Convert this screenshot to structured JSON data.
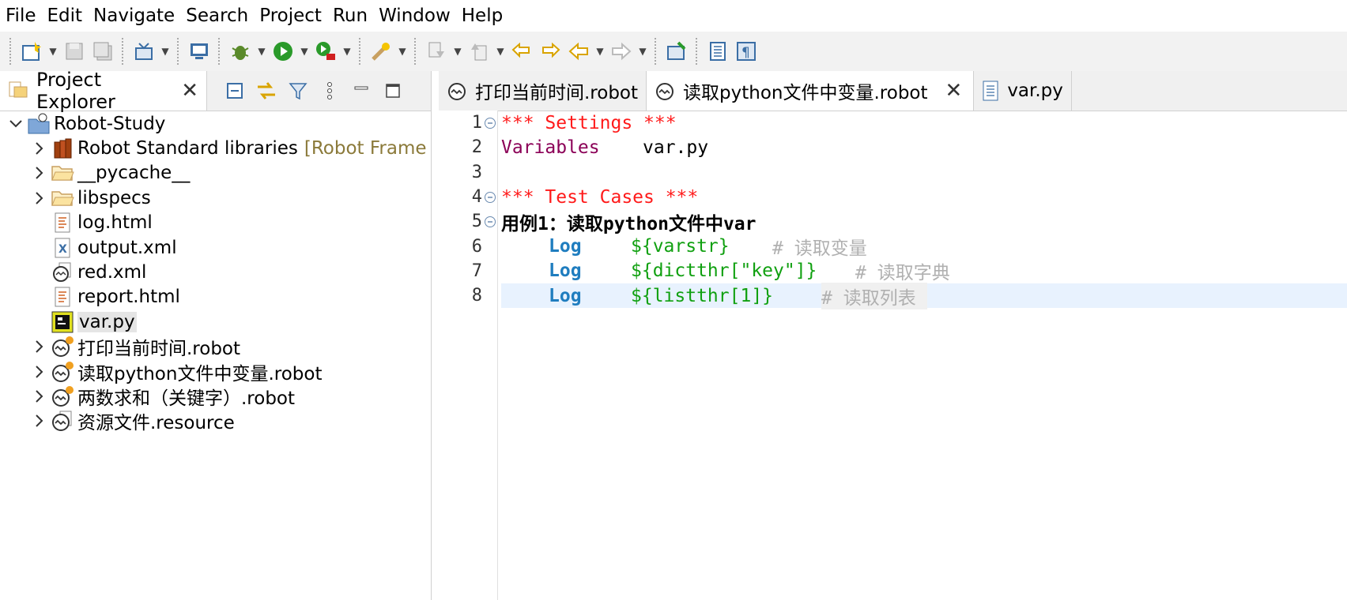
{
  "menu": [
    "File",
    "Edit",
    "Navigate",
    "Search",
    "Project",
    "Run",
    "Window",
    "Help"
  ],
  "project_explorer": {
    "title": "Project Explorer",
    "tree": [
      {
        "label": "Robot-Study",
        "depth": 0,
        "expanded": true,
        "icon": "project-folder-icon"
      },
      {
        "label": "Robot Standard libraries",
        "decoration": "[Robot Frame",
        "depth": 1,
        "icon": "library-icon"
      },
      {
        "label": "__pycache__",
        "depth": 1,
        "icon": "folder-icon"
      },
      {
        "label": "libspecs",
        "depth": 1,
        "icon": "folder-icon"
      },
      {
        "label": "log.html",
        "depth": 1,
        "icon": "html-file-icon"
      },
      {
        "label": "output.xml",
        "depth": 1,
        "icon": "xml-file-icon"
      },
      {
        "label": "red.xml",
        "depth": 1,
        "icon": "robot-config-icon"
      },
      {
        "label": "report.html",
        "depth": 1,
        "icon": "html-file-icon"
      },
      {
        "label": "var.py",
        "depth": 1,
        "icon": "python-file-icon",
        "selected": true
      },
      {
        "label": "打印当前时间.robot",
        "depth": 1,
        "icon": "robot-file-icon"
      },
      {
        "label": "读取python文件中变量.robot",
        "depth": 1,
        "icon": "robot-file-icon"
      },
      {
        "label": "两数求和（关键字）.robot",
        "depth": 1,
        "icon": "robot-file-icon"
      },
      {
        "label": "资源文件.resource",
        "depth": 1,
        "icon": "robot-resource-icon"
      }
    ]
  },
  "editor_tabs": [
    {
      "label": "打印当前时间.robot",
      "active": false
    },
    {
      "label": "读取python文件中变量.robot",
      "active": true
    },
    {
      "label": "var.py",
      "active": false
    }
  ],
  "editor": {
    "line_numbers": [
      "1",
      "2",
      "3",
      "4",
      "5",
      "6",
      "7",
      "8"
    ],
    "line1": "*** Settings ***",
    "line2_kw": "Variables",
    "line2_val": "var.py",
    "line4": "*** Test Cases ***",
    "line5_a": "用例",
    "line5_b": "1",
    "line5_c": "：读取",
    "line5_d": "python",
    "line5_e": "文件中",
    "line5_f": "var",
    "line6_kw": "Log",
    "line6_var": "${varstr}",
    "line6_cmt": "# 读取变量",
    "line7_kw": "Log",
    "line7_var": "${dictthr[\"key\"]}",
    "line7_cmt": "# 读取字典",
    "line8_kw": "Log",
    "line8_var": "${listthr[1]}",
    "line8_cmt": "# 读取列表"
  },
  "colors": {
    "section_header": "#ff1a1a",
    "setting_keyword": "#8b0057",
    "keyword": "#1f7dbf",
    "variable": "#10a010",
    "comment": "#b0b0b0",
    "current_line": "#e8f2fe"
  }
}
